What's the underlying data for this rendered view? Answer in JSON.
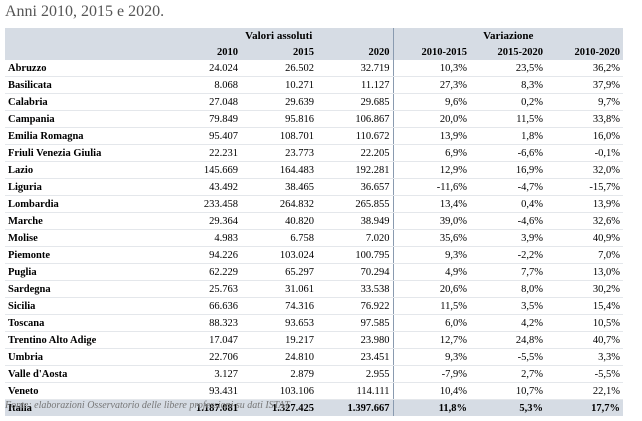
{
  "caption": "Anni 2010, 2015 e 2020.",
  "groups": {
    "absolute": "Valori assoluti",
    "variation": "Variazione"
  },
  "columns": [
    "2010",
    "2015",
    "2020",
    "2010-2015",
    "2015-2020",
    "2010-2020"
  ],
  "rows": [
    [
      "Abruzzo",
      "24.024",
      "26.502",
      "32.719",
      "10,3%",
      "23,5%",
      "36,2%"
    ],
    [
      "Basilicata",
      "8.068",
      "10.271",
      "11.127",
      "27,3%",
      "8,3%",
      "37,9%"
    ],
    [
      "Calabria",
      "27.048",
      "29.639",
      "29.685",
      "9,6%",
      "0,2%",
      "9,7%"
    ],
    [
      "Campania",
      "79.849",
      "95.816",
      "106.867",
      "20,0%",
      "11,5%",
      "33,8%"
    ],
    [
      "Emilia Romagna",
      "95.407",
      "108.701",
      "110.672",
      "13,9%",
      "1,8%",
      "16,0%"
    ],
    [
      "Friuli Venezia Giulia",
      "22.231",
      "23.773",
      "22.205",
      "6,9%",
      "-6,6%",
      "-0,1%"
    ],
    [
      "Lazio",
      "145.669",
      "164.483",
      "192.281",
      "12,9%",
      "16,9%",
      "32,0%"
    ],
    [
      "Liguria",
      "43.492",
      "38.465",
      "36.657",
      "-11,6%",
      "-4,7%",
      "-15,7%"
    ],
    [
      "Lombardia",
      "233.458",
      "264.832",
      "265.855",
      "13,4%",
      "0,4%",
      "13,9%"
    ],
    [
      "Marche",
      "29.364",
      "40.820",
      "38.949",
      "39,0%",
      "-4,6%",
      "32,6%"
    ],
    [
      "Molise",
      "4.983",
      "6.758",
      "7.020",
      "35,6%",
      "3,9%",
      "40,9%"
    ],
    [
      "Piemonte",
      "94.226",
      "103.024",
      "100.795",
      "9,3%",
      "-2,2%",
      "7,0%"
    ],
    [
      "Puglia",
      "62.229",
      "65.297",
      "70.294",
      "4,9%",
      "7,7%",
      "13,0%"
    ],
    [
      "Sardegna",
      "25.763",
      "31.061",
      "33.538",
      "20,6%",
      "8,0%",
      "30,2%"
    ],
    [
      "Sicilia",
      "66.636",
      "74.316",
      "76.922",
      "11,5%",
      "3,5%",
      "15,4%"
    ],
    [
      "Toscana",
      "88.323",
      "93.653",
      "97.585",
      "6,0%",
      "4,2%",
      "10,5%"
    ],
    [
      "Trentino Alto Adige",
      "17.047",
      "19.217",
      "23.980",
      "12,7%",
      "24,8%",
      "40,7%"
    ],
    [
      "Umbria",
      "22.706",
      "24.810",
      "23.451",
      "9,3%",
      "-5,5%",
      "3,3%"
    ],
    [
      "Valle d'Aosta",
      "3.127",
      "2.879",
      "2.955",
      "-7,9%",
      "2,7%",
      "-5,5%"
    ],
    [
      "Veneto",
      "93.431",
      "103.106",
      "114.111",
      "10,4%",
      "10,7%",
      "22,1%"
    ]
  ],
  "total": [
    "Italia",
    "1.187.081",
    "1.327.425",
    "1.397.667",
    "11,8%",
    "5,3%",
    "17,7%"
  ],
  "footnote": "Fonte: elaborazioni Osservatorio delle libere professioni su dati ISTAT"
}
